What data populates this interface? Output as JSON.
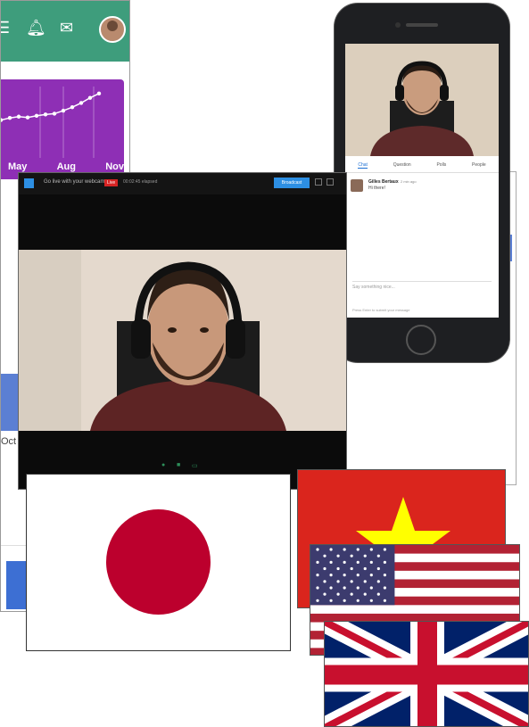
{
  "dashboard": {
    "chart_data": {
      "type": "line",
      "categories": [
        "May",
        "Aug",
        "Nov"
      ],
      "series": [
        {
          "values": [
            0.3,
            0.35,
            0.38,
            0.36,
            0.4,
            0.43,
            0.45,
            0.52,
            0.6,
            0.7,
            0.82,
            0.92
          ]
        }
      ],
      "grid": true
    },
    "months": [
      "May",
      "Aug",
      "Nov"
    ],
    "axis_fragment": "Oct",
    "colors": {
      "topbar": "#3e9d7c",
      "card": "#8e2fb5"
    }
  },
  "phone": {
    "tabs": [
      "Chat",
      "Question",
      "Polls",
      "People"
    ],
    "message": {
      "name": "Gilles Bertaux",
      "time": "2 min ago",
      "text": "Hi there!"
    },
    "input_placeholder": "Say something nice...",
    "hint": "Press Enter to submit your message"
  },
  "video_window": {
    "title": "Go live with your webcam",
    "live_label": "Live",
    "live_time": "00:02:45 elapsed",
    "action_button": "Broadcast"
  },
  "flags": [
    "Japan",
    "Vietnam",
    "United States",
    "United Kingdom"
  ]
}
